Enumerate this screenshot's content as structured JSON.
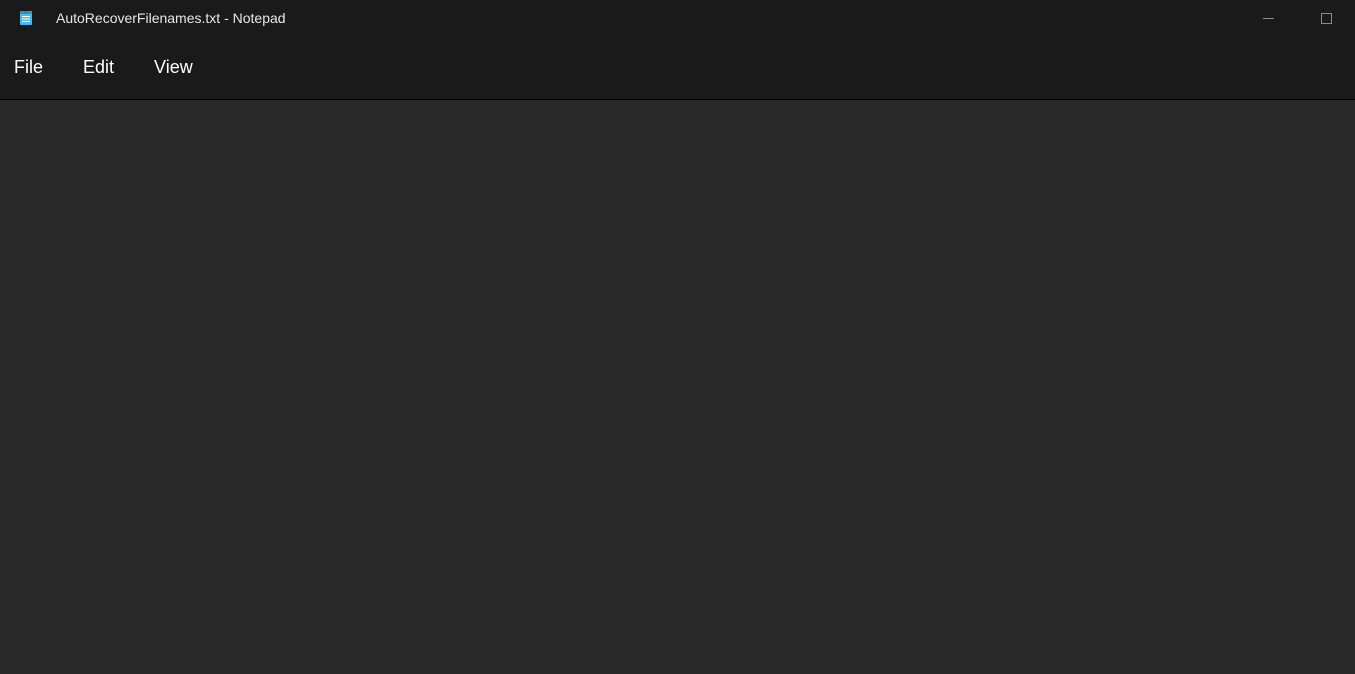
{
  "window": {
    "title": "AutoRecoverFilenames.txt - Notepad"
  },
  "menu": {
    "file": "File",
    "edit": "Edit",
    "view": "View"
  },
  "editor": {
    "content": ""
  }
}
